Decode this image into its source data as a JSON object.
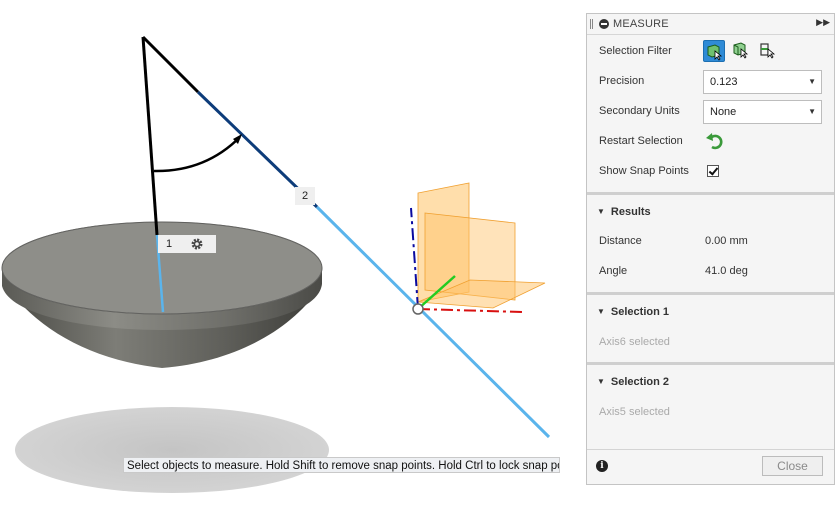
{
  "viewport": {
    "point_labels": [
      "1",
      "2"
    ],
    "status_text": "Select objects to measure. Hold Shift to remove snap points. Hold Ctrl to lock snap points."
  },
  "panel": {
    "title": "MEASURE",
    "selection_filter_label": "Selection Filter",
    "selection_filter_icons": [
      "body-select-icon",
      "face-select-icon",
      "edge-select-icon"
    ],
    "precision_label": "Precision",
    "precision_value": "0.123",
    "secondary_units_label": "Secondary Units",
    "secondary_units_value": "None",
    "restart_selection_label": "Restart Selection",
    "show_snap_points_label": "Show Snap Points",
    "show_snap_points_checked": true,
    "results_header": "Results",
    "distance_label": "Distance",
    "distance_value": "0.00 mm",
    "angle_label": "Angle",
    "angle_value": "41.0 deg",
    "selection1_header": "Selection 1",
    "selection1_value": "Axis6 selected",
    "selection2_header": "Selection 2",
    "selection2_value": "Axis5 selected",
    "close_label": "Close"
  },
  "colors": {
    "accent_blue": "#2f8bd6",
    "axis_light_blue": "#5ab4ec",
    "axis_dark_blue": "#0d3c7a",
    "plane_orange": "#ffc266",
    "restart_green": "#3a9a3a"
  }
}
